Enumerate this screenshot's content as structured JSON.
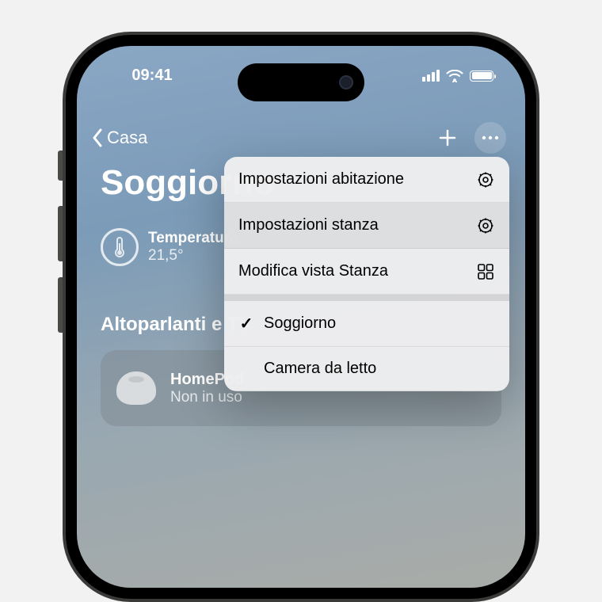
{
  "status": {
    "time": "09:41"
  },
  "nav": {
    "back_label": "Casa"
  },
  "page": {
    "title": "Soggiorno"
  },
  "climate": {
    "label": "Temperatura",
    "value": "21,5°"
  },
  "section": {
    "speakers_header": "Altoparlanti e TV"
  },
  "tile": {
    "name": "HomePod",
    "status": "Non in uso"
  },
  "menu": {
    "items": [
      {
        "label": "Impostazioni abitazione",
        "icon": "gear"
      },
      {
        "label": "Impostazioni stanza",
        "icon": "gear"
      },
      {
        "label": "Modifica vista Stanza",
        "icon": "grid"
      }
    ],
    "rooms": [
      {
        "label": "Soggiorno",
        "checked": true
      },
      {
        "label": "Camera da letto",
        "checked": false
      }
    ]
  }
}
